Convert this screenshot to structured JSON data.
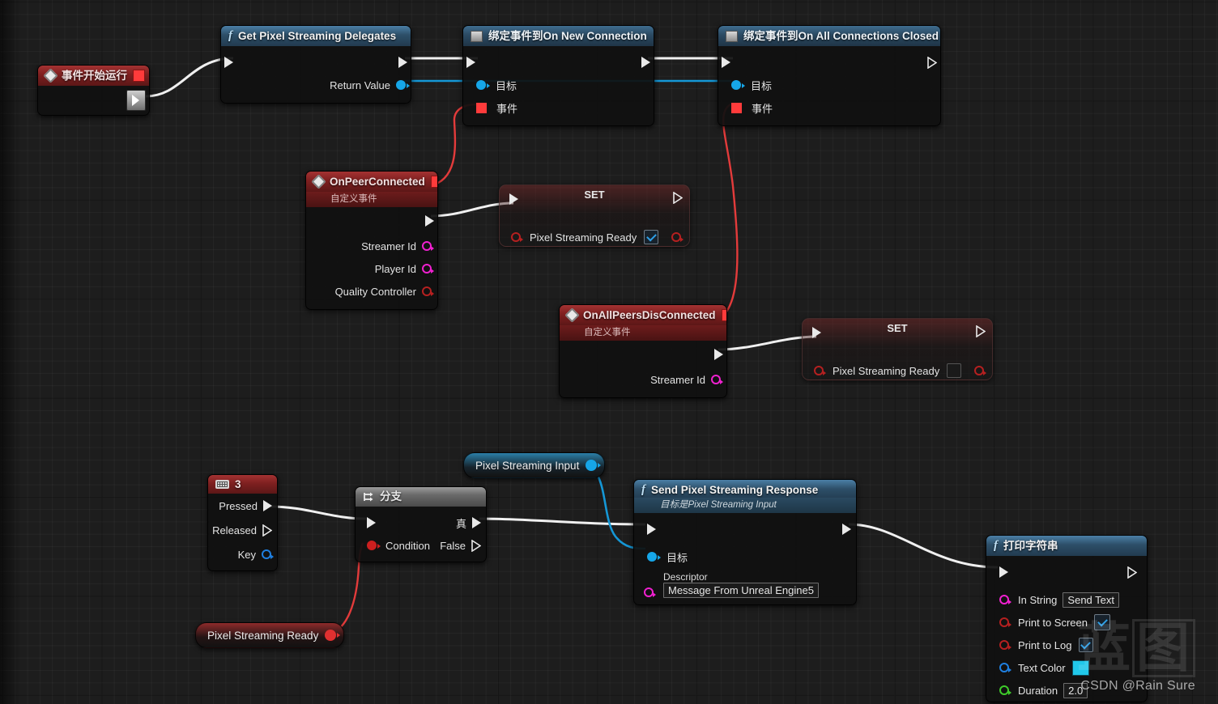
{
  "app": {
    "title": "Unreal Engine Blueprint Event Graph"
  },
  "watermark": {
    "chars_left": "蓝",
    "chars_right": "图",
    "credit": "CSDN @Rain Sure"
  },
  "nodes": {
    "begin_play": {
      "title": "事件开始运行",
      "icon": "event-diamond-icon"
    },
    "get_delegates": {
      "title": "Get Pixel Streaming Delegates",
      "icon": "function-fx-icon",
      "return_label": "Return Value"
    },
    "bind_new_connection": {
      "title": "绑定事件到On New Connection",
      "title_prefix": "绑定事件到",
      "title_suffix": "On New Connection",
      "target_label": "目标",
      "event_label": "事件"
    },
    "bind_all_closed": {
      "title": "绑定事件到On All Connections Closed",
      "title_prefix": "绑定事件到",
      "title_suffix": "On All Connections Closed",
      "target_label": "目标",
      "event_label": "事件"
    },
    "on_peer_connected": {
      "title": "OnPeerConnected",
      "subtitle": "自定义事件",
      "pins": [
        "Streamer Id",
        "Player Id",
        "Quality Controller"
      ]
    },
    "set_ready_true": {
      "title": "SET",
      "var_label": "Pixel Streaming Ready",
      "value": true
    },
    "on_all_peers_disconnected": {
      "title": "OnAllPeersDisConnected",
      "subtitle": "自定义事件",
      "pins": [
        "Streamer Id"
      ]
    },
    "set_ready_false": {
      "title": "SET",
      "var_label": "Pixel Streaming Ready",
      "value": false
    },
    "key_3": {
      "title": "3",
      "icon": "keyboard-icon",
      "pressed_label": "Pressed",
      "released_label": "Released",
      "key_label": "Key"
    },
    "branch": {
      "title": "分支",
      "icon": "branch-icon",
      "condition_label": "Condition",
      "true_label": "真",
      "false_label": "False"
    },
    "getter_ps_input": {
      "label": "Pixel Streaming Input"
    },
    "getter_ps_ready": {
      "label": "Pixel Streaming Ready"
    },
    "send_response": {
      "title": "Send Pixel Streaming Response",
      "subtitle": "目标是Pixel Streaming Input",
      "icon": "function-fx-icon",
      "target_label": "目标",
      "descriptor_label": "Descriptor",
      "descriptor_value": "Message From Unreal Engine5"
    },
    "print_string": {
      "title": "打印字符串",
      "icon": "function-fx-icon",
      "in_string_label": "In String",
      "in_string_value": "Send Text",
      "print_to_screen_label": "Print to Screen",
      "print_to_screen_value": true,
      "print_to_log_label": "Print to Log",
      "print_to_log_value": true,
      "text_color_label": "Text Color",
      "text_color_value": "#21c8ea",
      "duration_label": "Duration",
      "duration_value": "2.0"
    }
  },
  "colors": {
    "exec_wire": "#f0f0f0",
    "object_wire": "#1597d6",
    "delegate_wire": "#e33b3b",
    "bool_pin": "#b52020",
    "string_pin": "#f020d0",
    "float_pin": "#3ecb2a",
    "object_pin": "#16a6e8",
    "event_header": "#8b2424",
    "function_header": "#2d4f68"
  }
}
